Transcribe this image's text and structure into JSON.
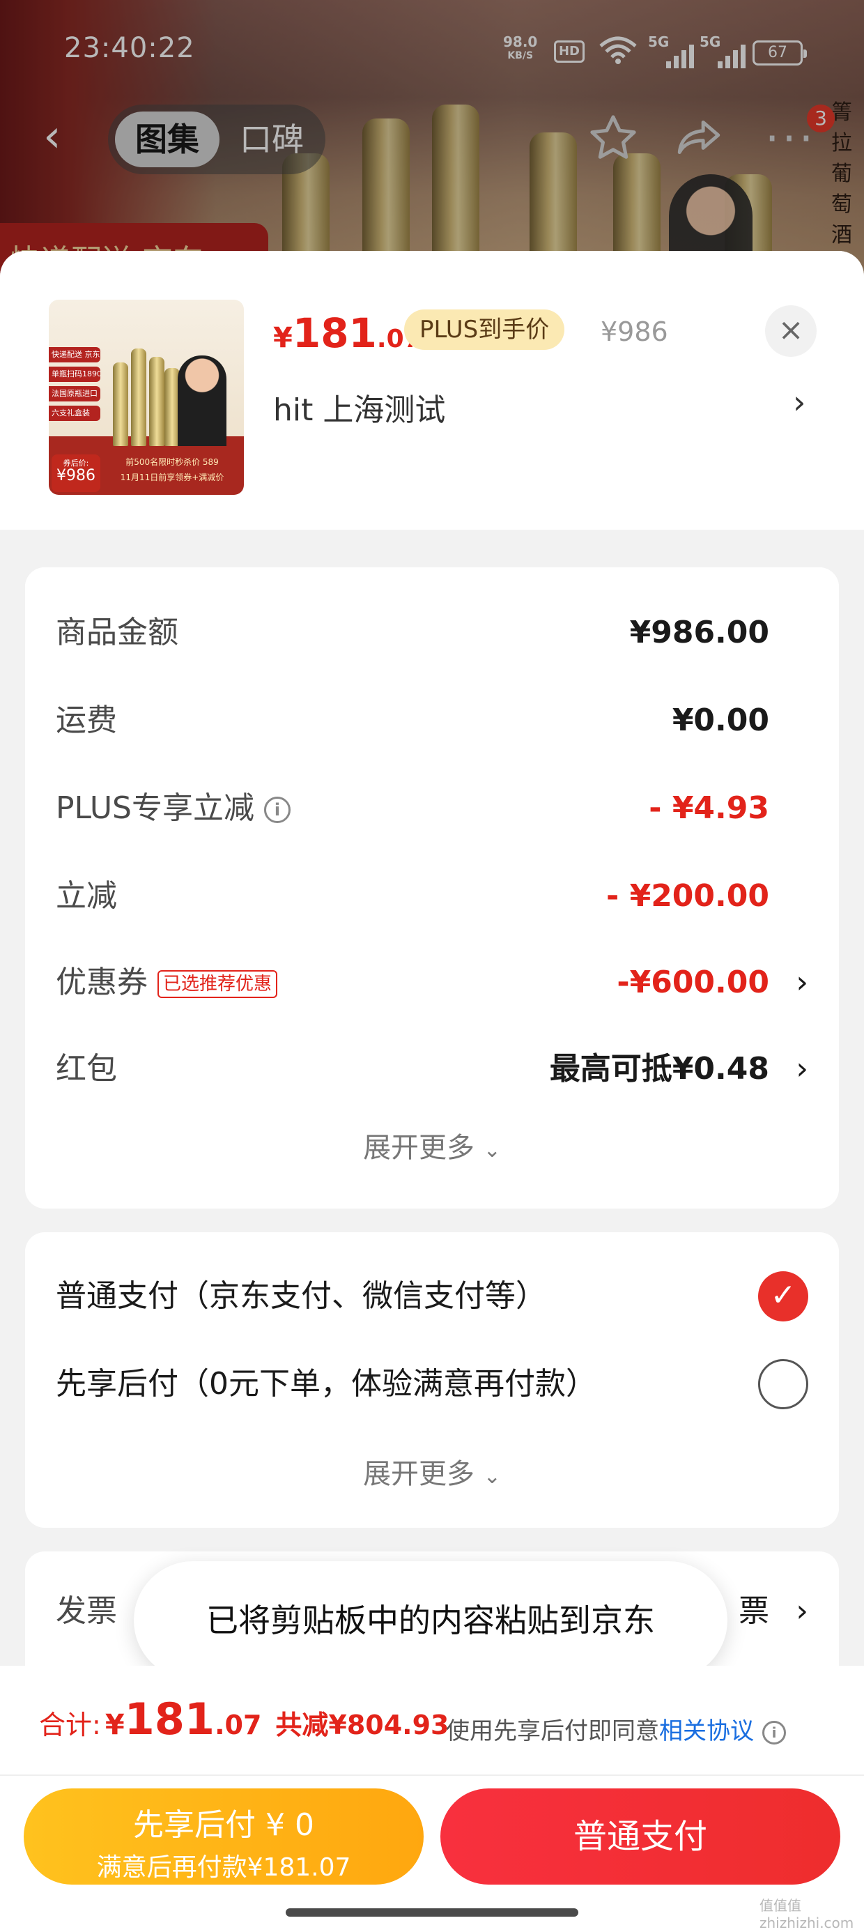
{
  "status_bar": {
    "time": "23:40:22",
    "net_speed": "98.0",
    "net_unit": "KB/S",
    "hd": "HD",
    "sim1": "5G",
    "sim2": "5G",
    "battery": "67"
  },
  "nav": {
    "tabs": [
      {
        "label": "图集",
        "active": true
      },
      {
        "label": "口碑",
        "active": false
      }
    ],
    "badge_count": "3",
    "icons": [
      "back-icon",
      "star-icon",
      "share-icon",
      "more-icon"
    ]
  },
  "background": {
    "vertical_text": [
      "箐",
      "拉",
      "葡",
      "萄",
      "酒"
    ],
    "red_label": "快递配送 京东"
  },
  "product": {
    "thumb_labels": [
      "快递配送 京东",
      "单瓶扫码1890",
      "法国原瓶进口",
      "六支礼盒装"
    ],
    "thumb_price_label": "券后价:",
    "thumb_price": "¥986",
    "thumb_banner_1": "前500名限时秒杀价 589",
    "thumb_banner_2": "11月11日前享领券+满减价",
    "price_currency": "¥",
    "price_int": "181",
    "price_dec": ".07",
    "plus_tag": "PLUS到手价",
    "orig_price": "¥986",
    "address": "hit  上海测试"
  },
  "summary": {
    "rows": [
      {
        "label": "商品金额",
        "value": "¥986.00",
        "red": false
      },
      {
        "label": "运费",
        "value": "¥0.00",
        "red": false
      },
      {
        "label": "PLUS专享立减",
        "value": "- ¥4.93",
        "red": true
      },
      {
        "label": "立减",
        "value": "- ¥200.00",
        "red": true
      },
      {
        "label": "优惠券",
        "tag": "已选推荐优惠",
        "value": "-¥600.00",
        "red": true
      },
      {
        "label": "红包",
        "value": "最高可抵¥0.48",
        "red": false
      }
    ],
    "expand_label": "展开更多"
  },
  "payment": {
    "options": [
      {
        "label": "普通支付（京东支付、微信支付等）",
        "selected": true
      },
      {
        "label": "先享后付（0元下单，体验满意再付款）",
        "selected": false
      }
    ],
    "expand_label": "展开更多"
  },
  "invoice": {
    "label": "发票",
    "value_tail": "票"
  },
  "toast": "已将剪贴板中的内容粘贴到京东",
  "footer": {
    "total_label": "合计:",
    "total_currency": "¥",
    "total_int": "181",
    "total_dec": ".07",
    "saved": "共减¥804.93",
    "agree_text": "使用先享后付即同意",
    "agree_link": "相关协议",
    "btn_later_line1": "先享后付 ¥ 0",
    "btn_later_line2": "满意后再付款¥181.07",
    "btn_pay": "普通支付",
    "watermark": "值值值 zhizhizhi.com"
  },
  "colors": {
    "accent_red": "#e2231a",
    "plus_gold": "#fbe9b3",
    "later_yellow": "#ffb618",
    "pay_red": "#f42f3a",
    "link_blue": "#1a6ee0"
  }
}
